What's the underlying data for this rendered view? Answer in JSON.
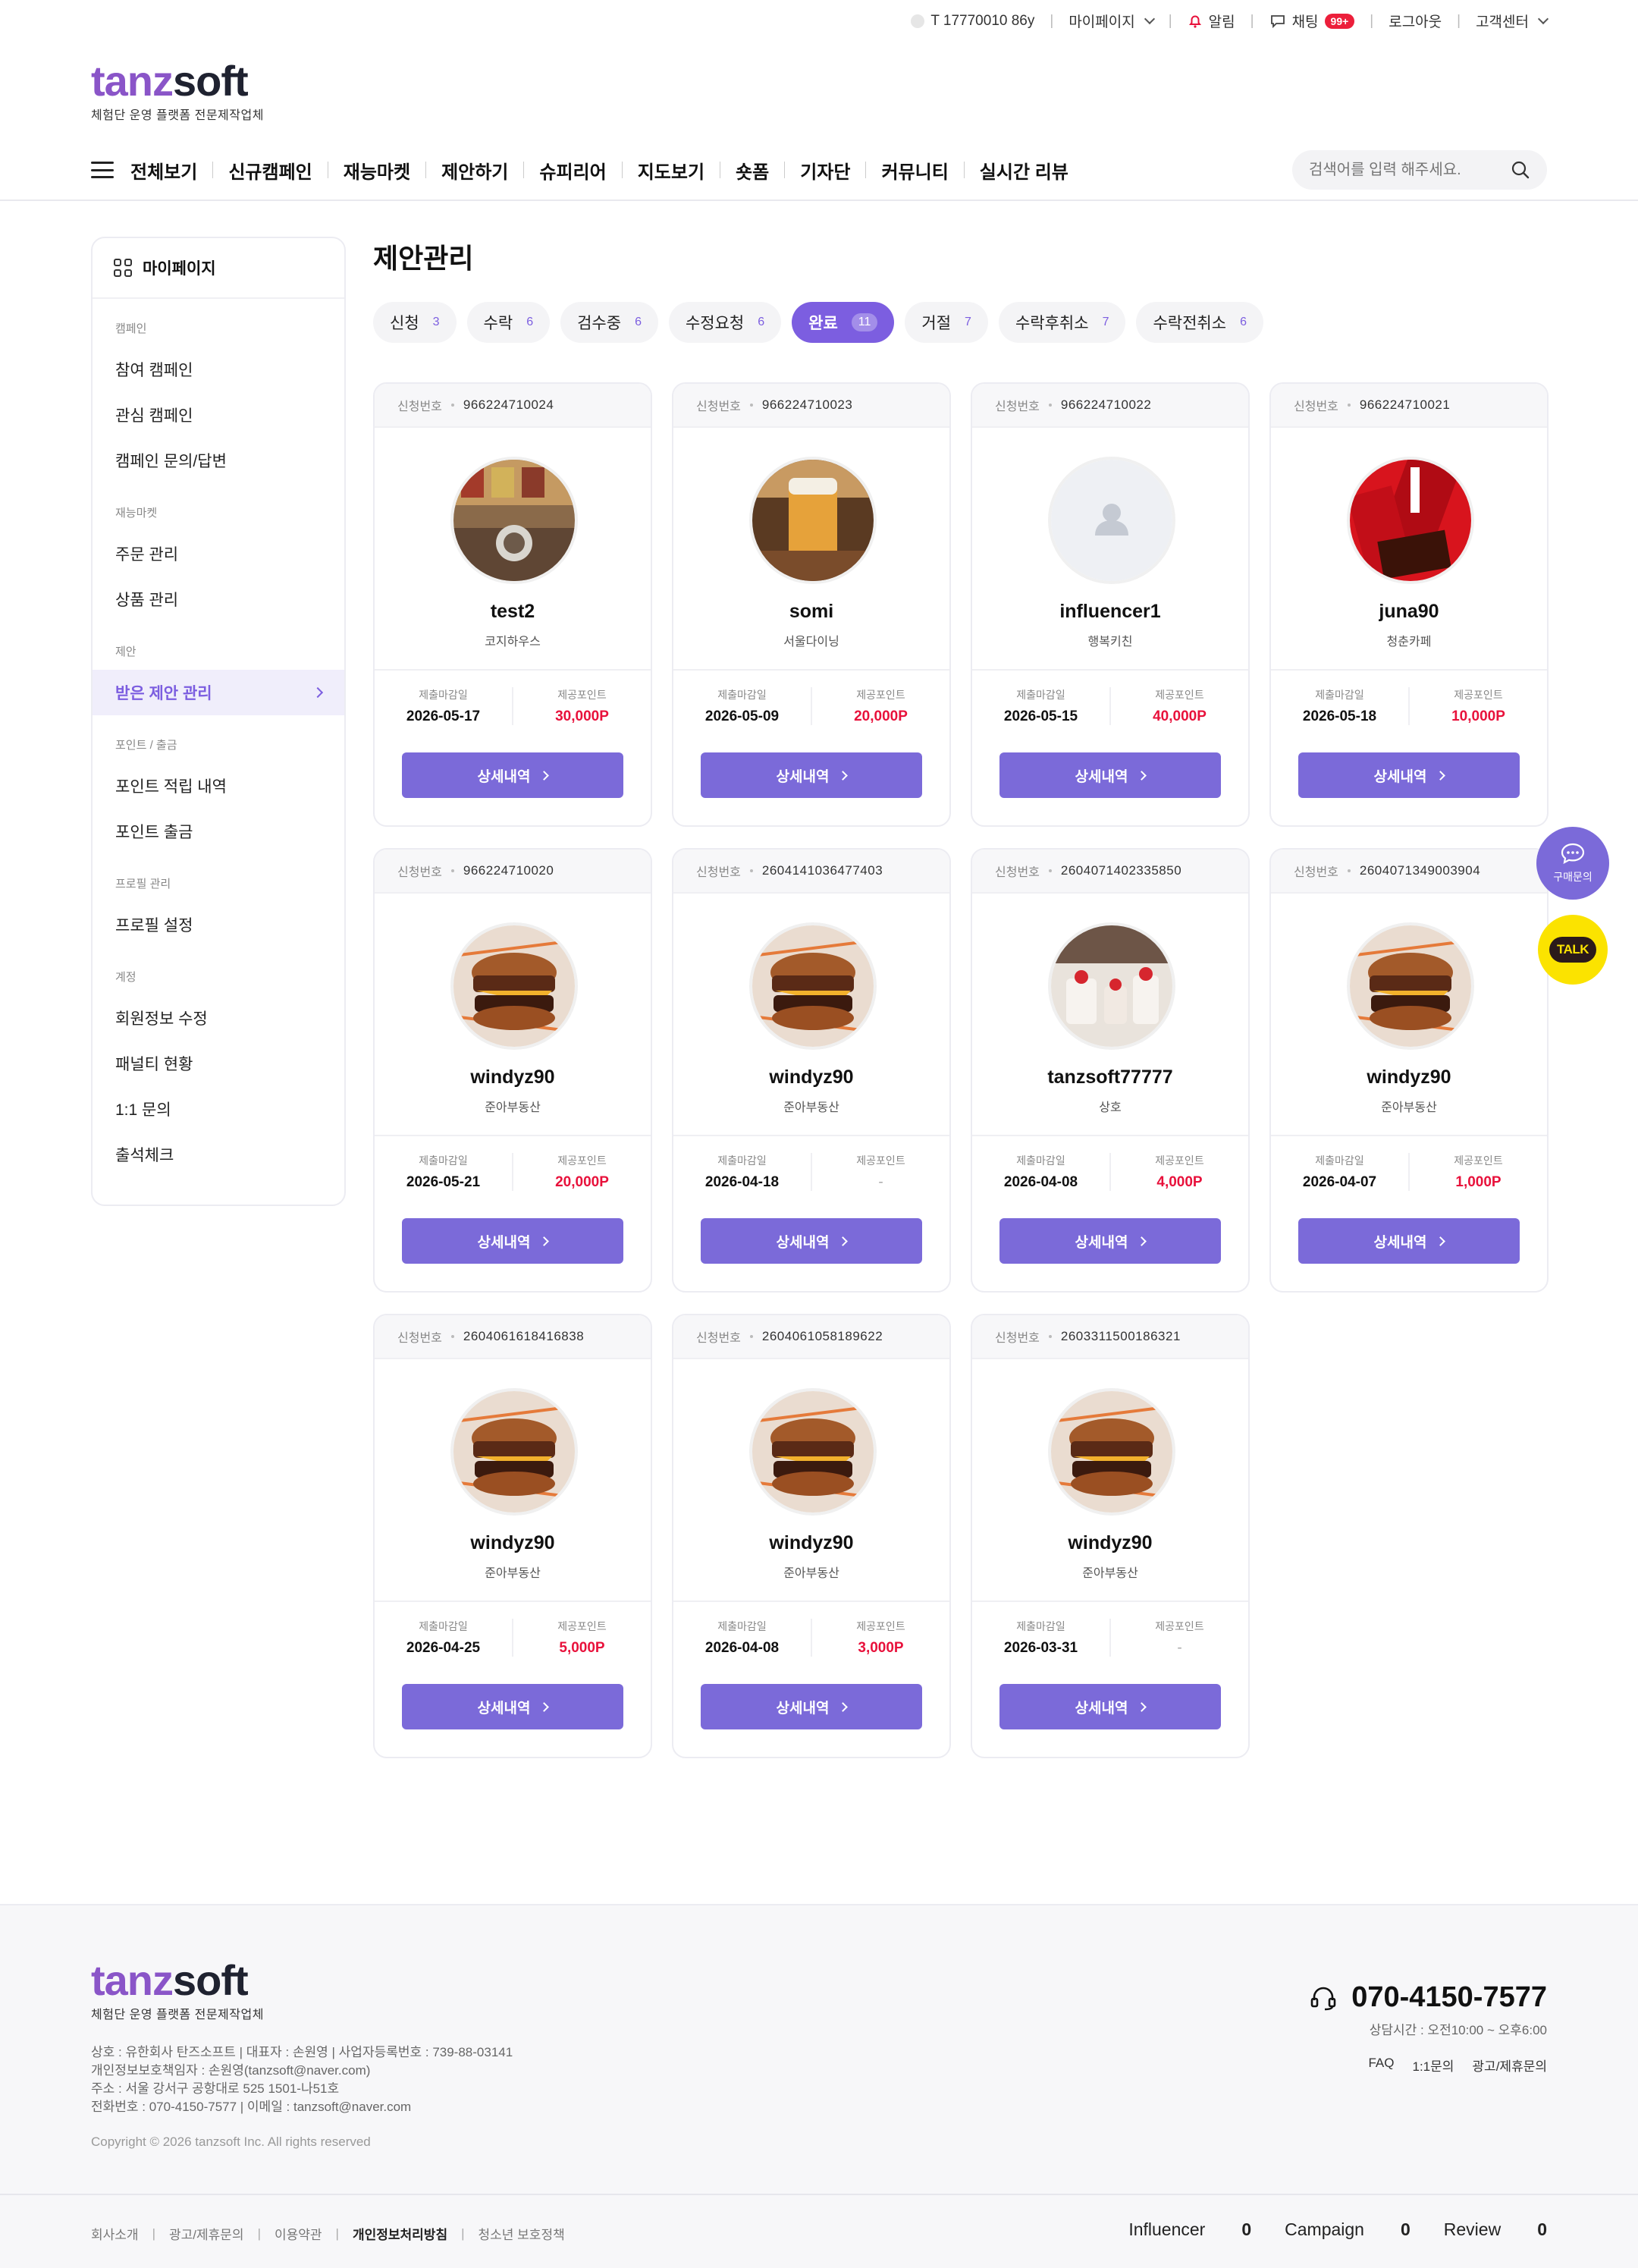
{
  "util_bar": {
    "user_id": "T 17770010 86y",
    "mypage_label": "마이페이지",
    "alarm_label": "알림",
    "chat_label": "채팅",
    "chat_badge": "99+",
    "logout_label": "로그아웃",
    "support_label": "고객센터"
  },
  "logo": {
    "part1": "tanz",
    "part2": "soft",
    "tagline": "체험단 운영 플랫폼 전문제작업체"
  },
  "nav": {
    "items": [
      "전체보기",
      "신규캠페인",
      "재능마켓",
      "제안하기",
      "슈피리어",
      "지도보기",
      "숏폼",
      "기자단",
      "커뮤니티",
      "실시간 리뷰"
    ],
    "search_placeholder": "검색어를 입력 해주세요."
  },
  "sidebar": {
    "title": "마이페이지",
    "groups": [
      {
        "title": "캠페인",
        "items": [
          "참여 캠페인",
          "관심 캠페인",
          "캠페인 문의/답변"
        ]
      },
      {
        "title": "재능마켓",
        "items": [
          "주문 관리",
          "상품 관리"
        ]
      },
      {
        "title": "제안",
        "items": [
          "받은 제안 관리"
        ]
      },
      {
        "title": "포인트 / 출금",
        "items": [
          "포인트 적립 내역",
          "포인트 출금"
        ]
      },
      {
        "title": "프로필 관리",
        "items": [
          "프로필 설정"
        ]
      },
      {
        "title": "계정",
        "items": [
          "회원정보 수정",
          "패널티 현황",
          "1:1 문의",
          "출석체크"
        ]
      }
    ]
  },
  "page": {
    "title": "제안관리"
  },
  "tabs": [
    {
      "label": "신청",
      "count": "3"
    },
    {
      "label": "수락",
      "count": "6"
    },
    {
      "label": "검수중",
      "count": "6"
    },
    {
      "label": "수정요청",
      "count": "6"
    },
    {
      "label": "완료",
      "count": "11",
      "active": true
    },
    {
      "label": "거절",
      "count": "7"
    },
    {
      "label": "수락후취소",
      "count": "7"
    },
    {
      "label": "수락전취소",
      "count": "6"
    }
  ],
  "card_labels": {
    "req_no": "신청번호",
    "deadline": "제출마감일",
    "points": "제공포인트",
    "button": "상세내역"
  },
  "cards": [
    {
      "no": "966224710024",
      "name": "test2",
      "store": "코지하우스",
      "deadline": "2026-05-17",
      "points": "30,000P",
      "img": "cafe-interior"
    },
    {
      "no": "966224710023",
      "name": "somi",
      "store": "서울다이닝",
      "deadline": "2026-05-09",
      "points": "20,000P",
      "img": "beer"
    },
    {
      "no": "966224710022",
      "name": "influencer1",
      "store": "행복키친",
      "deadline": "2026-05-15",
      "points": "40,000P",
      "img": "placeholder"
    },
    {
      "no": "966224710021",
      "name": "juna90",
      "store": "청춘카페",
      "deadline": "2026-05-18",
      "points": "10,000P",
      "img": "pepero"
    },
    {
      "no": "966224710020",
      "name": "windyz90",
      "store": "준아부동산",
      "deadline": "2026-05-21",
      "points": "20,000P",
      "img": "burger"
    },
    {
      "no": "2604141036477403",
      "name": "windyz90",
      "store": "준아부동산",
      "deadline": "2026-04-18",
      "points": "-",
      "img": "burger"
    },
    {
      "no": "2604071402335850",
      "name": "tanzsoft77777",
      "store": "상호",
      "deadline": "2026-04-08",
      "points": "4,000P",
      "img": "dessert"
    },
    {
      "no": "2604071349003904",
      "name": "windyz90",
      "store": "준아부동산",
      "deadline": "2026-04-07",
      "points": "1,000P",
      "img": "burger"
    },
    {
      "no": "2604061618416838",
      "name": "windyz90",
      "store": "준아부동산",
      "deadline": "2026-04-25",
      "points": "5,000P",
      "img": "burger"
    },
    {
      "no": "2604061058189622",
      "name": "windyz90",
      "store": "준아부동산",
      "deadline": "2026-04-08",
      "points": "3,000P",
      "img": "burger"
    },
    {
      "no": "2603311500186321",
      "name": "windyz90",
      "store": "준아부동산",
      "deadline": "2026-03-31",
      "points": "-",
      "img": "burger"
    }
  ],
  "floating": {
    "chat_label": "구매문의",
    "talk_label": "TALK"
  },
  "footer": {
    "info_lines": [
      "상호 : 유한회사 탄즈소프트 | 대표자 : 손원영 | 사업자등록번호 : 739-88-03141",
      "개인정보보호책임자 : 손원영(tanzsoft@naver.com)",
      "주소 : 서울 강서구 공항대로 525 1501-나51호",
      "전화번호 : 070-4150-7577 | 이메일 : tanzsoft@naver.com"
    ],
    "copyright": "Copyright © 2026 tanzsoft Inc. All rights reserved",
    "phone": "070-4150-7577",
    "hours": "상담시간 : 오전10:00 ~ 오후6:00",
    "links": [
      "FAQ",
      "1:1문의",
      "광고/제휴문의"
    ],
    "bottom_links": [
      "회사소개",
      "광고/제휴문의",
      "이용약관",
      "개인정보처리방침",
      "청소년 보호정책"
    ],
    "stats": [
      {
        "label": "Influencer",
        "value": "0"
      },
      {
        "label": "Campaign",
        "value": "0"
      },
      {
        "label": "Review",
        "value": "0"
      }
    ]
  },
  "colors": {
    "accent": "#7b6ad9",
    "point_red": "#e8113b",
    "logo_purple": "#8a55c8"
  }
}
